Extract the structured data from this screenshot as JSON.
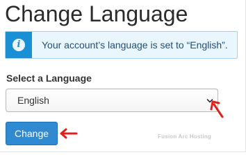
{
  "page": {
    "title": "Change Language"
  },
  "alert": {
    "icon": "info-icon",
    "icon_glyph": "i",
    "text": "Your account’s language is set to “English”.",
    "colors": {
      "strip": "#1a8fd4",
      "background": "#e9f6fd",
      "text": "#1f4f7a"
    }
  },
  "form": {
    "select_label": "Select a Language",
    "select_value": "English",
    "submit_label": "Change",
    "submit_color": "#2f8ad2"
  },
  "annotations": {
    "arrow_color": "#e0201b"
  },
  "watermark": {
    "text": "Fusion Arc Hosting"
  }
}
